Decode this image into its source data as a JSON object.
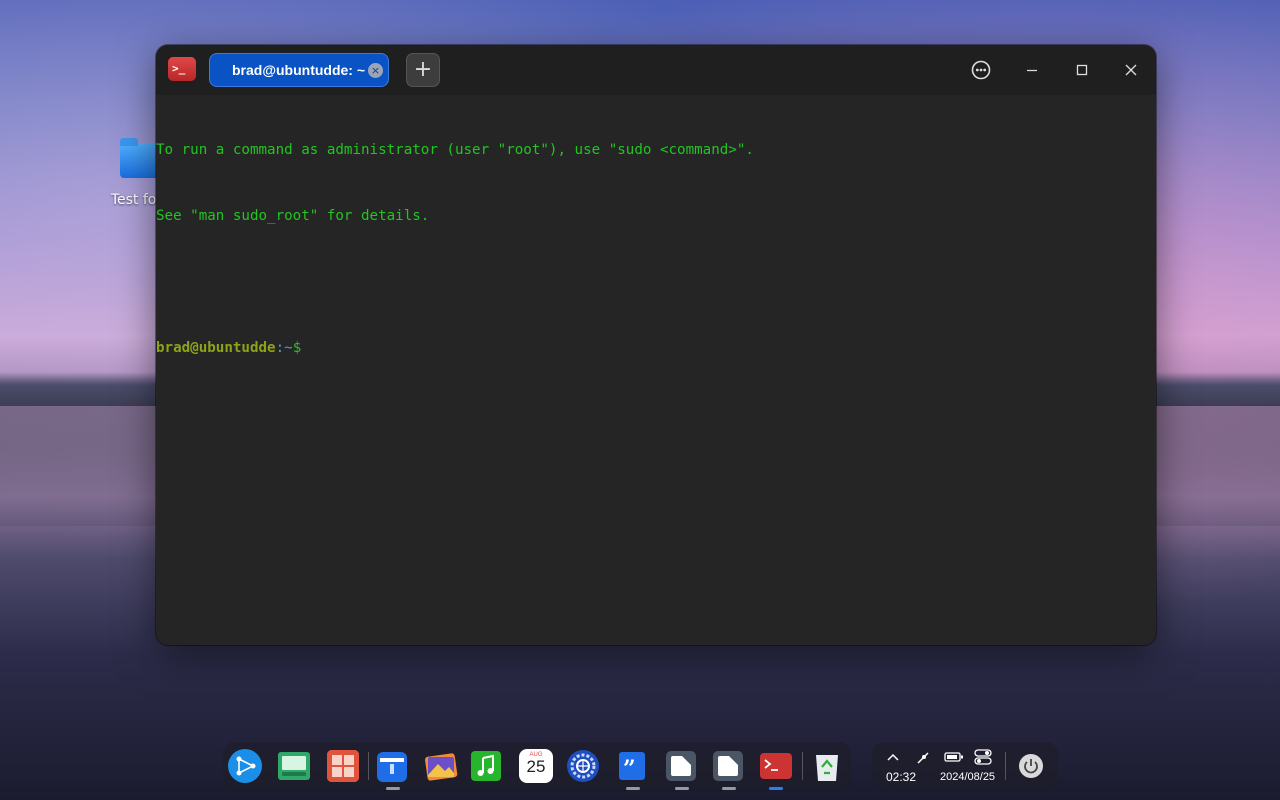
{
  "desktop": {
    "icons": [
      {
        "label": "Test fold",
        "icon": "folder-icon"
      }
    ]
  },
  "terminal": {
    "app_icon": "terminal-icon",
    "tab": {
      "label": "brad@ubuntudde: ~",
      "close_glyph": "×"
    },
    "new_tab_glyph": "+",
    "window_controls": [
      "more-icon",
      "minimize-icon",
      "maximize-icon",
      "close-icon"
    ],
    "lines": [
      "To run a command as administrator (user \"root\"), use \"sudo <command>\".",
      "See \"man sudo_root\" for details.",
      ""
    ],
    "prompt": {
      "user_host": "brad@ubuntudde",
      "path": ":~",
      "sign": "$"
    },
    "colors": {
      "text": "#21c521",
      "user": "#8fa318",
      "path": "#4a9bd6",
      "background": "#252525"
    }
  },
  "dock": {
    "items": [
      {
        "name": "launcher",
        "icon": "launcher-icon"
      },
      {
        "name": "multitasking",
        "icon": "multitasking-view-icon"
      },
      {
        "name": "window-manager",
        "icon": "grid-apps-icon"
      },
      {
        "name": "file-manager",
        "icon": "file-manager-icon"
      },
      {
        "name": "image-viewer",
        "icon": "photos-icon"
      },
      {
        "name": "music",
        "icon": "music-icon"
      },
      {
        "name": "calendar",
        "icon": "calendar-icon",
        "month": "AUG",
        "day": "25"
      },
      {
        "name": "settings",
        "icon": "settings-gear-icon"
      },
      {
        "name": "editor",
        "icon": "quote-editor-icon"
      },
      {
        "name": "window-a",
        "icon": "window-icon"
      },
      {
        "name": "window-b",
        "icon": "window-icon"
      },
      {
        "name": "terminal",
        "icon": "terminal-icon"
      },
      {
        "name": "trash",
        "icon": "trash-recycle-icon"
      }
    ]
  },
  "tray": {
    "icons": [
      "chevron-up-icon",
      "network-icon",
      "battery-icon",
      "toggle-settings-icon"
    ],
    "time": "02:32",
    "date": "2024/08/25",
    "power_icon": "power-icon"
  }
}
